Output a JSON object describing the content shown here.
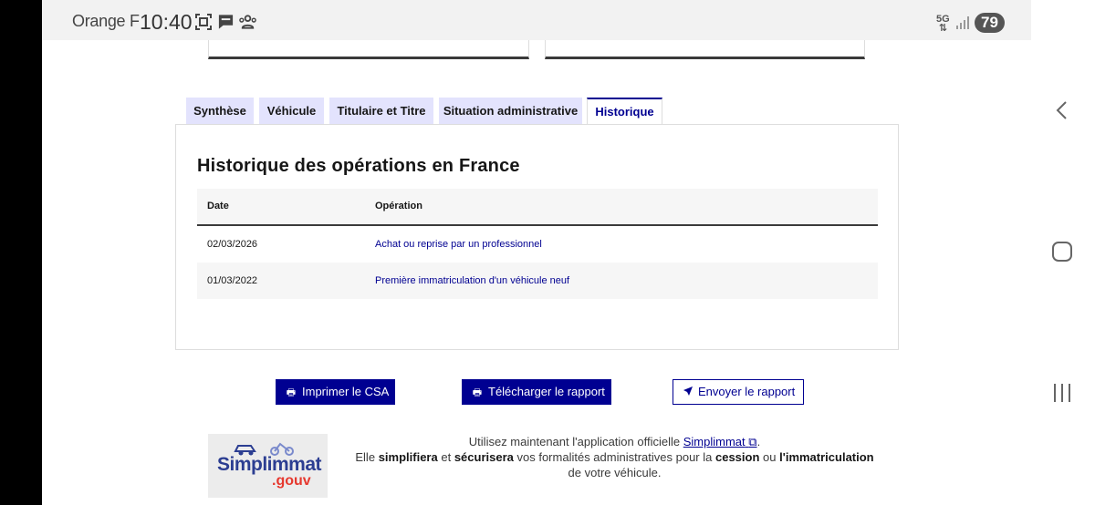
{
  "status_bar": {
    "carrier": "Orange F",
    "time": "10:40",
    "network": "5G",
    "battery": "79"
  },
  "tabs": [
    {
      "label": "Synthèse"
    },
    {
      "label": "Véhicule"
    },
    {
      "label": "Titulaire et Titre"
    },
    {
      "label": "Situation administrative"
    },
    {
      "label": "Historique"
    }
  ],
  "active_tab": "Historique",
  "panel": {
    "title": "Historique des opérations en France",
    "columns": [
      "Date",
      "Opération"
    ],
    "rows": [
      {
        "date": "02/03/2026",
        "operation": "Achat ou reprise par un professionnel"
      },
      {
        "date": "01/03/2022",
        "operation": "Première immatriculation d'un véhicule neuf"
      }
    ]
  },
  "actions": {
    "print": "Imprimer le CSA",
    "download": "Télécharger le rapport",
    "send": "Envoyer le rapport"
  },
  "promo": {
    "logo_name": "Simplimmat",
    "logo_suffix": ".gouv",
    "line1_prefix": "Utilisez maintenant l'application officielle",
    "link": "Simplimmat",
    "line1_suffix": ".",
    "line2_a": "Elle",
    "bold1": "simplifiera",
    "line2_b": "et",
    "bold2": "sécurisera",
    "line2_c": "vos formalités administratives pour la",
    "bold3": "cession",
    "line2_d": "ou",
    "bold4": "l'immatriculation",
    "line2_e": "de votre véhicule."
  },
  "colors": {
    "primary": "#000091",
    "tab_bg": "#e3e3fd",
    "alt_row": "#f6f6f6"
  }
}
